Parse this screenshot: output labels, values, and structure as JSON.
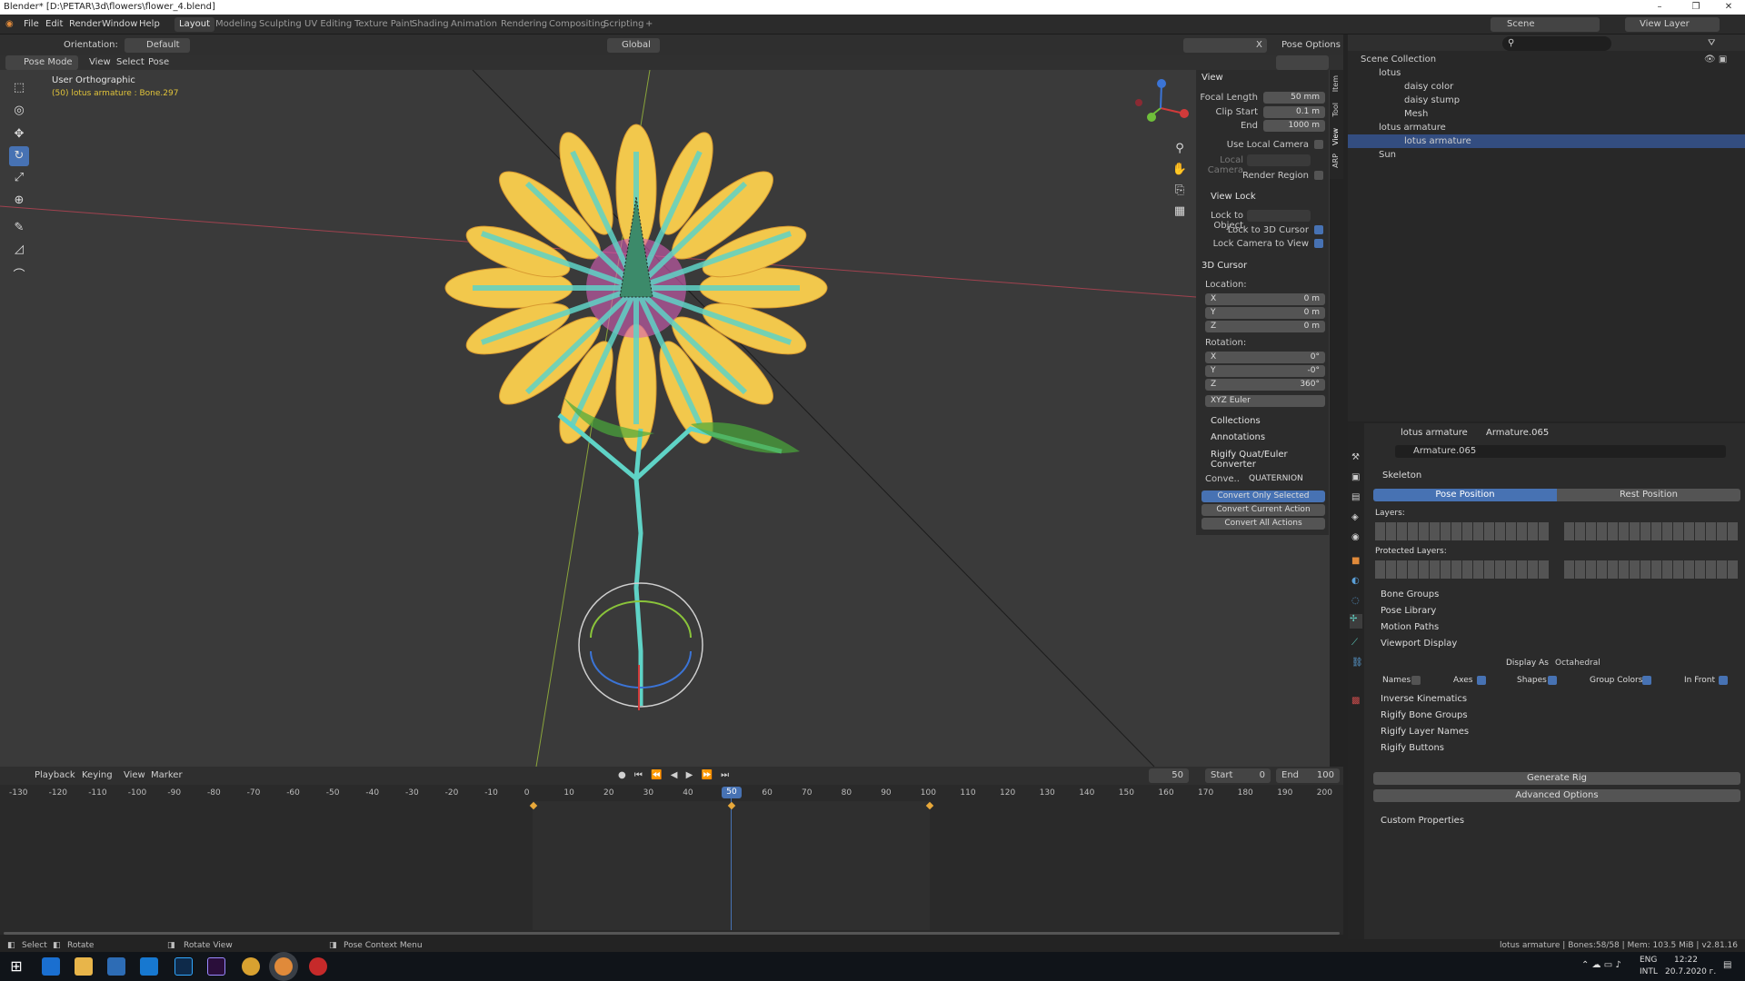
{
  "titlebar": {
    "title": "Blender* [D:\\PETAR\\3d\\flowers\\flower_4.blend]"
  },
  "menu": [
    "File",
    "Edit",
    "Render",
    "Window",
    "Help"
  ],
  "workspaces": [
    "Layout",
    "Modeling",
    "Sculpting",
    "UV Editing",
    "Texture Paint",
    "Shading",
    "Animation",
    "Rendering",
    "Compositing",
    "Scripting",
    "+"
  ],
  "scene": {
    "label": "Scene",
    "view_layer": "View Layer"
  },
  "toolheader": {
    "orientation_label": "Orientation:",
    "orientation_value": "Default",
    "transform": "Global",
    "pose_options": "Pose Options"
  },
  "viewheader": {
    "mode": "Pose Mode",
    "items": [
      "View",
      "Select",
      "Pose"
    ]
  },
  "viewport": {
    "view_name": "User Orthographic",
    "active_info": "(50) lotus armature : Bone.297",
    "gizmo_x": "X"
  },
  "npanel": {
    "tabs": [
      "Item",
      "Tool",
      "View",
      "ARP"
    ],
    "view": {
      "title": "View",
      "focal_length_label": "Focal Length",
      "focal_length": "50 mm",
      "clip_start_label": "Clip Start",
      "clip_start": "0.1 m",
      "end_label": "End",
      "end": "1000 m",
      "use_local_camera": "Use Local Camera",
      "local_camera": "Local Camera",
      "render_region": "Render Region"
    },
    "view_lock": {
      "title": "View Lock",
      "lock_to_object": "Lock to Object",
      "lock_to_3d_cursor": "Lock to 3D Cursor",
      "lock_camera_to_view": "Lock Camera to View"
    },
    "cursor": {
      "title": "3D Cursor",
      "location_label": "Location:",
      "loc": [
        {
          "axis": "X",
          "value": "0 m"
        },
        {
          "axis": "Y",
          "value": "0 m"
        },
        {
          "axis": "Z",
          "value": "0 m"
        }
      ],
      "rotation_label": "Rotation:",
      "rot": [
        {
          "axis": "X",
          "value": "0°"
        },
        {
          "axis": "Y",
          "value": "-0°"
        },
        {
          "axis": "Z",
          "value": "360°"
        }
      ],
      "mode": "XYZ Euler"
    },
    "collapsed": [
      "Collections",
      "Annotations"
    ],
    "rigify": {
      "title": "Rigify Quat/Euler Converter",
      "conv_label": "Conve..",
      "conv_value": "QUATERNION",
      "buttons": [
        "Convert Only Selected",
        "Convert Current Action",
        "Convert All Actions"
      ]
    }
  },
  "outliner": {
    "search_placeholder": "",
    "rows": [
      "Scene Collection",
      "lotus",
      "daisy color",
      "daisy stump",
      "Mesh",
      "lotus armature",
      "lotus armature",
      "Sun"
    ]
  },
  "properties": {
    "breadcrumb": [
      "lotus armature",
      "Armature.065"
    ],
    "datablock": "Armature.065",
    "skeleton": {
      "title": "Skeleton",
      "pose_position": "Pose Position",
      "rest_position": "Rest Position",
      "layers": "Layers:",
      "protected_layers": "Protected Layers:"
    },
    "panels_a": [
      "Bone Groups",
      "Pose Library",
      "Motion Paths"
    ],
    "viewport_display": {
      "title": "Viewport Display",
      "display_as_label": "Display As",
      "display_as": "Octahedral",
      "names": "Names",
      "axes": "Axes",
      "shapes": "Shapes",
      "group_colors": "Group Colors",
      "in_front": "In Front"
    },
    "panels_b": [
      "Inverse Kinematics",
      "Rigify Bone Groups",
      "Rigify Layer Names"
    ],
    "rigify_buttons": {
      "title": "Rigify Buttons",
      "generate": "Generate Rig",
      "advanced": "Advanced Options"
    },
    "custom": "Custom Properties"
  },
  "timeline": {
    "menu": [
      "Playback",
      "Keying",
      "View",
      "Marker"
    ],
    "current_frame": "50",
    "start_label": "Start",
    "start": "0",
    "end_label": "End",
    "end": "100",
    "ticks": [
      "-130",
      "-120",
      "-110",
      "-100",
      "-90",
      "-80",
      "-70",
      "-60",
      "-50",
      "-40",
      "-30",
      "-20",
      "-10",
      "0",
      "10",
      "20",
      "30",
      "40",
      "50",
      "60",
      "70",
      "80",
      "90",
      "100",
      "110",
      "120",
      "130",
      "140",
      "150",
      "160",
      "170",
      "180",
      "190",
      "200"
    ]
  },
  "statusbar": {
    "select": "Select",
    "rotate": "Rotate",
    "rotate_view": "Rotate View",
    "context_menu": "Pose Context Menu",
    "info": "lotus armature | Bones:58/58 | Mem: 103.5 MiB | v2.81.16"
  },
  "taskbar": {
    "lang1": "ENG",
    "lang2": "INTL",
    "time": "12:22",
    "date": "20.7.2020 г."
  },
  "colors": {
    "accent": "#4772b3",
    "active_frame": "#4772b3",
    "keyframe": "#e8a83a"
  }
}
